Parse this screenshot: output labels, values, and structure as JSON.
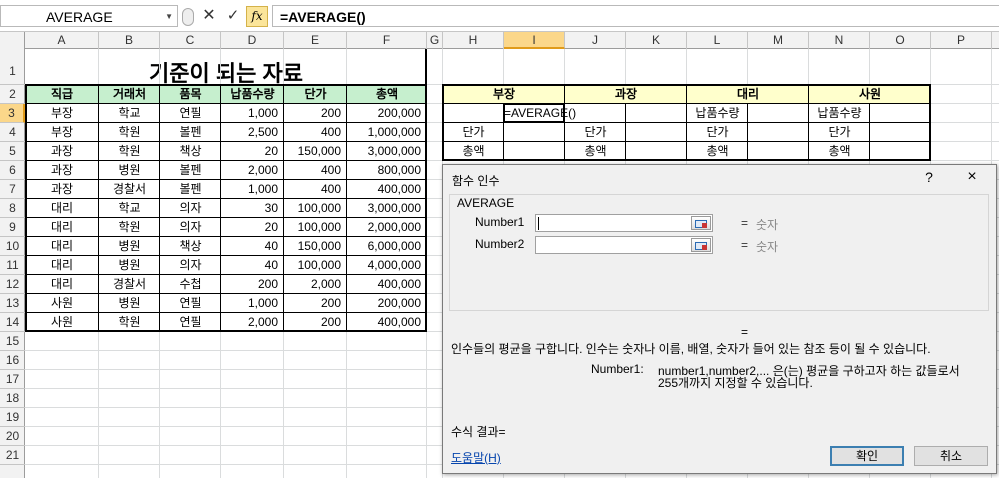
{
  "formula_bar": {
    "name_box": "AVERAGE",
    "cancel_icon": "close-icon",
    "enter_icon": "check-icon",
    "fx_label": "fx",
    "formula": "=AVERAGE()"
  },
  "columns": [
    "A",
    "B",
    "C",
    "D",
    "E",
    "F",
    "G",
    "H",
    "I",
    "J",
    "K",
    "L",
    "M",
    "N",
    "O",
    "P"
  ],
  "rows": [
    "1",
    "2",
    "3",
    "4",
    "5",
    "6",
    "7",
    "8",
    "9",
    "10",
    "11",
    "12",
    "13",
    "14",
    "15",
    "16",
    "17",
    "18",
    "19",
    "20",
    "21"
  ],
  "sheet_title": "기준이 되는 자료",
  "table": {
    "headers": [
      "직급",
      "거래처",
      "품목",
      "납품수량",
      "단가",
      "총액"
    ],
    "rows": [
      [
        "부장",
        "학교",
        "연필",
        "1,000",
        "200",
        "200,000"
      ],
      [
        "부장",
        "학원",
        "볼펜",
        "2,500",
        "400",
        "1,000,000"
      ],
      [
        "과장",
        "학원",
        "책상",
        "20",
        "150,000",
        "3,000,000"
      ],
      [
        "과장",
        "병원",
        "볼펜",
        "2,000",
        "400",
        "800,000"
      ],
      [
        "과장",
        "경찰서",
        "볼펜",
        "1,000",
        "400",
        "400,000"
      ],
      [
        "대리",
        "학교",
        "의자",
        "30",
        "100,000",
        "3,000,000"
      ],
      [
        "대리",
        "학원",
        "의자",
        "20",
        "100,000",
        "2,000,000"
      ],
      [
        "대리",
        "병원",
        "책상",
        "40",
        "150,000",
        "6,000,000"
      ],
      [
        "대리",
        "병원",
        "의자",
        "40",
        "100,000",
        "4,000,000"
      ],
      [
        "대리",
        "경찰서",
        "수첩",
        "200",
        "2,000",
        "400,000"
      ],
      [
        "사원",
        "병원",
        "연필",
        "1,000",
        "200",
        "200,000"
      ],
      [
        "사원",
        "학원",
        "연필",
        "2,000",
        "200",
        "400,000"
      ]
    ]
  },
  "summary": {
    "groups": [
      "부장",
      "과장",
      "대리",
      "사원"
    ],
    "editing_cell": "=AVERAGE()",
    "qty_label": "납품수량",
    "price_label": "단가",
    "total_label": "총액"
  },
  "dialog": {
    "title": "함수 인수",
    "help_icon": "?",
    "close_icon": "×",
    "function_name": "AVERAGE",
    "args": [
      {
        "label": "Number1",
        "eq": "=",
        "value": "숫자"
      },
      {
        "label": "Number2",
        "eq": "=",
        "value": "숫자"
      }
    ],
    "result_eq": "=",
    "description": "인수들의 평균을 구합니다. 인수는 숫자나 이름, 배열, 숫자가 들어 있는 참조 등이 될 수 있습니다.",
    "arg_name": "Number1:",
    "arg_desc_line1": "number1,number2,... 은(는) 평균을 구하고자 하는 값들로서",
    "arg_desc_line2": "255개까지 지정할 수 있습니다.",
    "formula_result": "수식 결과=",
    "help_link": "도움말(H)",
    "ok": "확인",
    "cancel": "취소"
  }
}
